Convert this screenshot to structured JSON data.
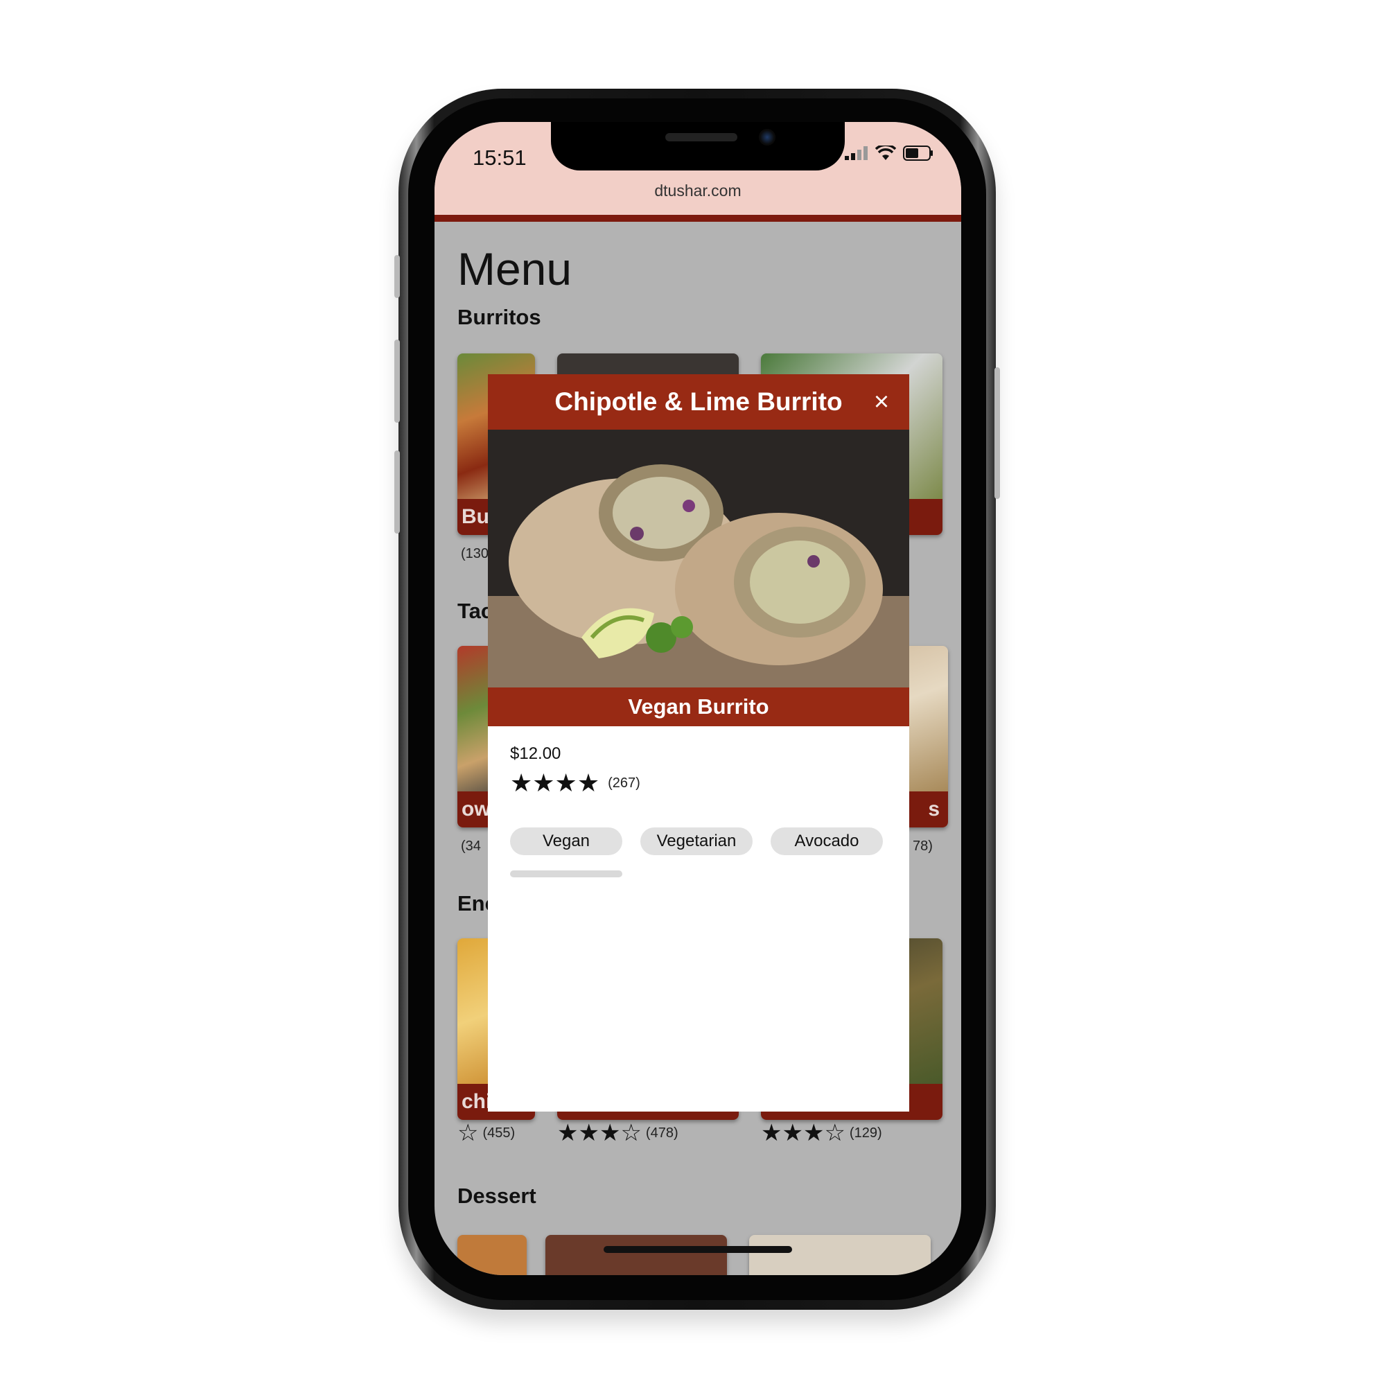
{
  "status_bar": {
    "time": "15:51",
    "url": "dtushar.com"
  },
  "page": {
    "title": "Menu",
    "categories": [
      {
        "name": "Burritos",
        "items": [
          {
            "label": "Bur",
            "rating_count": "(130"
          },
          {
            "label": "",
            "rating_count": ""
          },
          {
            "label": "",
            "rating_count": ""
          }
        ]
      },
      {
        "name": "Tac",
        "items": [
          {
            "label": "ow",
            "rating_count": "(34"
          },
          {
            "label": "",
            "rating_count": ""
          },
          {
            "label": "s",
            "rating_count": "78)"
          }
        ]
      },
      {
        "name": "Enc",
        "items": [
          {
            "label": "chi",
            "rating_count": "(455)",
            "stars": "☆"
          },
          {
            "label": "",
            "rating_count": "(478)",
            "stars": "★★★☆"
          },
          {
            "label": "",
            "rating_count": "(129)",
            "stars": "★★★☆"
          }
        ]
      },
      {
        "name": "Dessert",
        "items": []
      }
    ]
  },
  "modal": {
    "title": "Chipotle & Lime Burrito",
    "close_label": "×",
    "subtitle": "Vegan Burrito",
    "price": "$12.00",
    "stars": "★★★★",
    "rating_count": "(267)",
    "tags": [
      "Vegan",
      "Vegetarian",
      "Avocado"
    ]
  },
  "colors": {
    "brand": "#982a14",
    "chrome": "#f2cfc7"
  }
}
